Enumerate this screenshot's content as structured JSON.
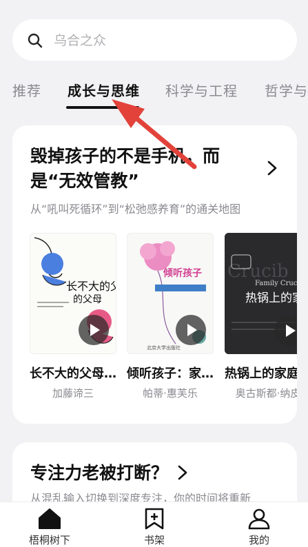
{
  "search": {
    "placeholder": "乌合之众"
  },
  "tabs": [
    {
      "label": "推荐"
    },
    {
      "label": "成长与思维"
    },
    {
      "label": "科学与工程"
    },
    {
      "label": "哲学与人"
    }
  ],
  "card1": {
    "title_line1": "毁掉孩子的不是手机，而",
    "title_line2": "是“无效管教”",
    "subtitle": "从“吼叫死循环”到“松弛感养育”的通关地图",
    "books": [
      {
        "title": "长不大的父母…",
        "author": "加藤谛三",
        "cover_text": "长不大的父母"
      },
      {
        "title": "倾听孩子：家…",
        "author": "帕蒂·惠芙乐",
        "cover_text": "倾听孩子"
      },
      {
        "title": "热锅上的家庭",
        "author": "奥古斯都·纳皮",
        "cover_text": "热锅上的家庭"
      }
    ]
  },
  "card2": {
    "title": "专注力老被打断？",
    "subtitle": "从混乱输入切换到深度专注，你的时间将重新"
  },
  "bottom_nav": [
    {
      "label": "梧桐树下",
      "icon": "home-icon"
    },
    {
      "label": "书架",
      "icon": "bookmark-plus-icon"
    },
    {
      "label": "我的",
      "icon": "user-icon"
    }
  ]
}
